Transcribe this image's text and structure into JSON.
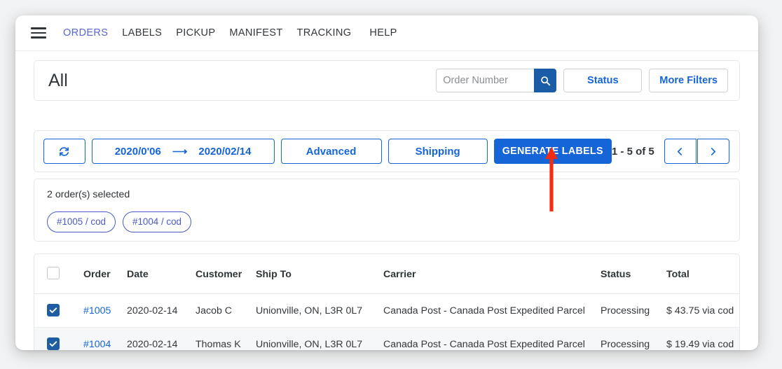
{
  "nav": {
    "menu_icon": "hamburger-icon",
    "items": [
      {
        "label": "ORDERS",
        "active": true
      },
      {
        "label": "LABELS",
        "active": false
      },
      {
        "label": "PICKUP",
        "active": false
      },
      {
        "label": "MANIFEST",
        "active": false
      },
      {
        "label": "TRACKING",
        "active": false
      },
      {
        "label": "HELP",
        "active": false
      }
    ]
  },
  "title_bar": {
    "title": "All",
    "search": {
      "placeholder": "Order Number",
      "value": "",
      "icon": "search-icon"
    },
    "status_button": "Status",
    "more_filters_button": "More Filters"
  },
  "toolbar": {
    "refresh_icon": "refresh-icon",
    "date_from": "2020/0'06",
    "date_arrow": "⟶",
    "date_to": "2020/02/14",
    "advanced_button": "Advanced",
    "shipping_button": "Shipping",
    "generate_labels_button": "GENERATE LABELS",
    "pagination_info": "1 - 5 of 5",
    "prev_icon": "chevron-left-icon",
    "next_icon": "chevron-right-icon"
  },
  "selection": {
    "count_text": "2 order(s) selected",
    "chips": [
      {
        "label": "#1005 / cod"
      },
      {
        "label": "#1004 / cod"
      }
    ]
  },
  "table": {
    "columns": [
      "Order",
      "Date",
      "Customer",
      "Ship To",
      "Carrier",
      "Status",
      "Total"
    ],
    "header_checkbox_checked": false,
    "rows": [
      {
        "checked": true,
        "order": "#1005",
        "date": "2020-02-14",
        "customer": "Jacob C",
        "ship_to": "Unionville, ON, L3R 0L7",
        "carrier": "Canada Post - Canada Post Expedited Parcel",
        "status": "Processing",
        "total": "$ 43.75 via cod"
      },
      {
        "checked": true,
        "order": "#1004",
        "date": "2020-02-14",
        "customer": "Thomas K",
        "ship_to": "Unionville, ON, L3R 0L7",
        "carrier": "Canada Post - Canada Post Expedited Parcel",
        "status": "Processing",
        "total": "$ 19.49 via cod"
      }
    ]
  },
  "annotation": {
    "arrow_color": "#f52c11",
    "points_to": "generate-labels-button"
  },
  "colors": {
    "accent_blue": "#1565d8",
    "search_button_blue": "#1a5da6",
    "nav_active_indigo": "#5866d6",
    "chip_indigo": "#4b5ac4",
    "checkbox_blue": "#1f5da3",
    "page_bg": "#f2f3f4",
    "row_alt_bg": "#f6f7f8"
  }
}
